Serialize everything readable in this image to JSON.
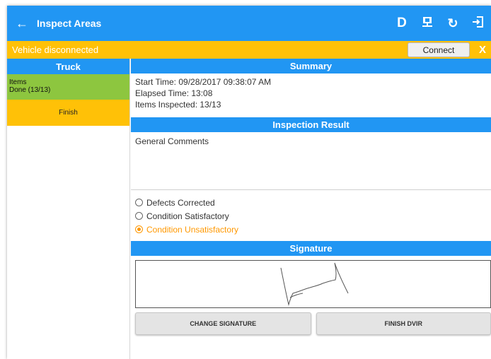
{
  "appbar": {
    "back_icon": "←",
    "title": "Inspect Areas",
    "actions": {
      "driver_label": "D",
      "network_icon": "⊞",
      "refresh_icon": "↻",
      "logout_icon": "⇥"
    }
  },
  "banner": {
    "message": "Vehicle disconnected",
    "connect_label": "Connect",
    "close_label": "X"
  },
  "sidebar": {
    "header": "Truck",
    "items_label": "Items",
    "items_status": "Done (13/13)",
    "finish_label": "Finish"
  },
  "summary": {
    "header": "Summary",
    "start_time": "Start Time: 09/28/2017 09:38:07 AM",
    "elapsed_time": "Elapsed Time: 13:08",
    "items_inspected": "Items Inspected: 13/13"
  },
  "inspection_result": {
    "header": "Inspection Result",
    "comments_label": "General Comments",
    "options": [
      {
        "label": "Defects Corrected",
        "selected": false
      },
      {
        "label": "Condition Satisfactory",
        "selected": false
      },
      {
        "label": "Condition Unsatisfactory",
        "selected": true
      }
    ]
  },
  "signature": {
    "header": "Signature",
    "change_label": "CHANGE SIGNATURE",
    "finish_label": "FINISH DVIR"
  },
  "colors": {
    "primary": "#2196f3",
    "banner": "#ffc107",
    "done": "#8dc63f",
    "selected": "#ff9800"
  }
}
